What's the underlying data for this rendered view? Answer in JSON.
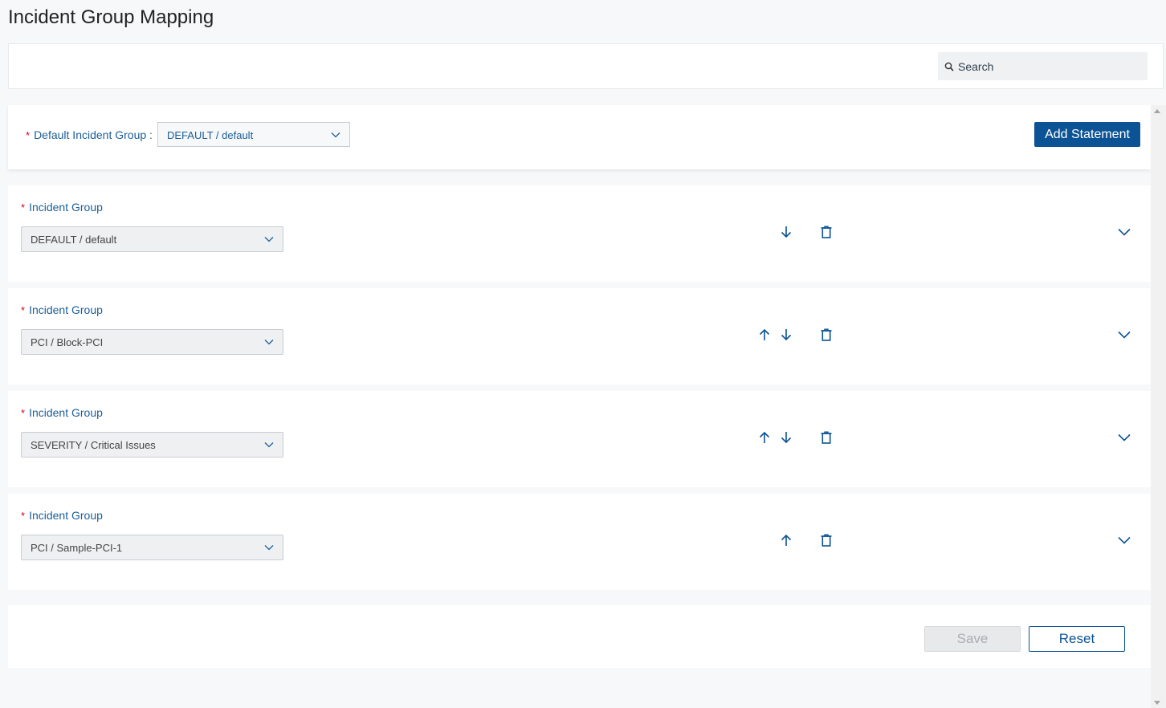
{
  "page": {
    "title": "Incident Group Mapping"
  },
  "search": {
    "placeholder": "Search"
  },
  "default_group": {
    "label": "Default Incident Group",
    "separator": ":",
    "required_mark": "*",
    "value": "DEFAULT / default"
  },
  "actions": {
    "add_statement": "Add Statement",
    "save": "Save",
    "reset": "Reset"
  },
  "statements": [
    {
      "label": "Incident Group",
      "required_mark": "*",
      "value": "DEFAULT / default",
      "can_move_up": false,
      "can_move_down": true
    },
    {
      "label": "Incident Group",
      "required_mark": "*",
      "value": "PCI / Block-PCI",
      "can_move_up": true,
      "can_move_down": true
    },
    {
      "label": "Incident Group",
      "required_mark": "*",
      "value": "SEVERITY / Critical Issues",
      "can_move_up": true,
      "can_move_down": true
    },
    {
      "label": "Incident Group",
      "required_mark": "*",
      "value": "PCI / Sample-PCI-1",
      "can_move_up": true,
      "can_move_down": false
    }
  ],
  "colors": {
    "primary": "#0b5394",
    "label_blue": "#1b5e9a",
    "required_red": "#d0021b",
    "disabled_bg": "#e8e9eb"
  }
}
